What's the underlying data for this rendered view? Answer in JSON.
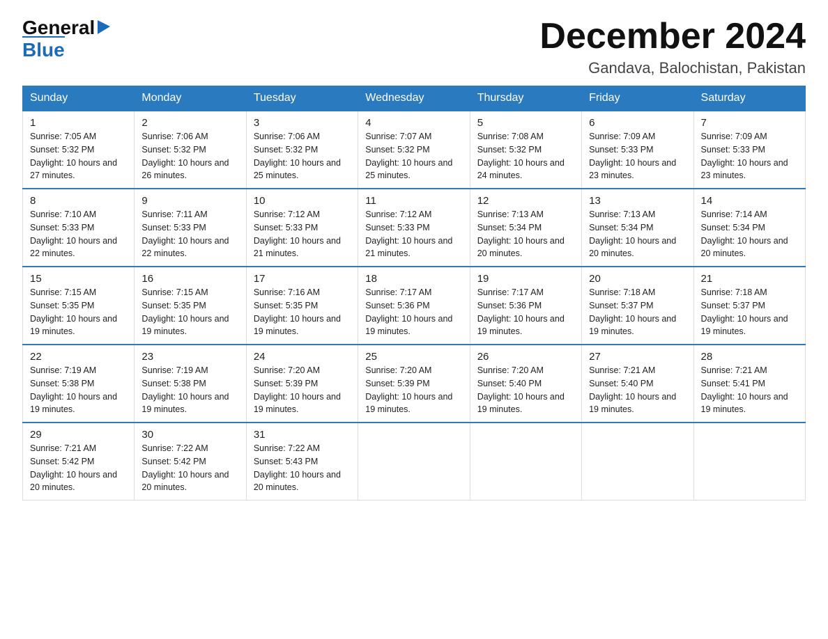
{
  "logo": {
    "general": "General",
    "blue": "Blue",
    "arrow": "▶"
  },
  "title": "December 2024",
  "subtitle": "Gandava, Balochistan, Pakistan",
  "days_of_week": [
    "Sunday",
    "Monday",
    "Tuesday",
    "Wednesday",
    "Thursday",
    "Friday",
    "Saturday"
  ],
  "weeks": [
    [
      {
        "day": "1",
        "sunrise": "7:05 AM",
        "sunset": "5:32 PM",
        "daylight": "10 hours and 27 minutes."
      },
      {
        "day": "2",
        "sunrise": "7:06 AM",
        "sunset": "5:32 PM",
        "daylight": "10 hours and 26 minutes."
      },
      {
        "day": "3",
        "sunrise": "7:06 AM",
        "sunset": "5:32 PM",
        "daylight": "10 hours and 25 minutes."
      },
      {
        "day": "4",
        "sunrise": "7:07 AM",
        "sunset": "5:32 PM",
        "daylight": "10 hours and 25 minutes."
      },
      {
        "day": "5",
        "sunrise": "7:08 AM",
        "sunset": "5:32 PM",
        "daylight": "10 hours and 24 minutes."
      },
      {
        "day": "6",
        "sunrise": "7:09 AM",
        "sunset": "5:33 PM",
        "daylight": "10 hours and 23 minutes."
      },
      {
        "day": "7",
        "sunrise": "7:09 AM",
        "sunset": "5:33 PM",
        "daylight": "10 hours and 23 minutes."
      }
    ],
    [
      {
        "day": "8",
        "sunrise": "7:10 AM",
        "sunset": "5:33 PM",
        "daylight": "10 hours and 22 minutes."
      },
      {
        "day": "9",
        "sunrise": "7:11 AM",
        "sunset": "5:33 PM",
        "daylight": "10 hours and 22 minutes."
      },
      {
        "day": "10",
        "sunrise": "7:12 AM",
        "sunset": "5:33 PM",
        "daylight": "10 hours and 21 minutes."
      },
      {
        "day": "11",
        "sunrise": "7:12 AM",
        "sunset": "5:33 PM",
        "daylight": "10 hours and 21 minutes."
      },
      {
        "day": "12",
        "sunrise": "7:13 AM",
        "sunset": "5:34 PM",
        "daylight": "10 hours and 20 minutes."
      },
      {
        "day": "13",
        "sunrise": "7:13 AM",
        "sunset": "5:34 PM",
        "daylight": "10 hours and 20 minutes."
      },
      {
        "day": "14",
        "sunrise": "7:14 AM",
        "sunset": "5:34 PM",
        "daylight": "10 hours and 20 minutes."
      }
    ],
    [
      {
        "day": "15",
        "sunrise": "7:15 AM",
        "sunset": "5:35 PM",
        "daylight": "10 hours and 19 minutes."
      },
      {
        "day": "16",
        "sunrise": "7:15 AM",
        "sunset": "5:35 PM",
        "daylight": "10 hours and 19 minutes."
      },
      {
        "day": "17",
        "sunrise": "7:16 AM",
        "sunset": "5:35 PM",
        "daylight": "10 hours and 19 minutes."
      },
      {
        "day": "18",
        "sunrise": "7:17 AM",
        "sunset": "5:36 PM",
        "daylight": "10 hours and 19 minutes."
      },
      {
        "day": "19",
        "sunrise": "7:17 AM",
        "sunset": "5:36 PM",
        "daylight": "10 hours and 19 minutes."
      },
      {
        "day": "20",
        "sunrise": "7:18 AM",
        "sunset": "5:37 PM",
        "daylight": "10 hours and 19 minutes."
      },
      {
        "day": "21",
        "sunrise": "7:18 AM",
        "sunset": "5:37 PM",
        "daylight": "10 hours and 19 minutes."
      }
    ],
    [
      {
        "day": "22",
        "sunrise": "7:19 AM",
        "sunset": "5:38 PM",
        "daylight": "10 hours and 19 minutes."
      },
      {
        "day": "23",
        "sunrise": "7:19 AM",
        "sunset": "5:38 PM",
        "daylight": "10 hours and 19 minutes."
      },
      {
        "day": "24",
        "sunrise": "7:20 AM",
        "sunset": "5:39 PM",
        "daylight": "10 hours and 19 minutes."
      },
      {
        "day": "25",
        "sunrise": "7:20 AM",
        "sunset": "5:39 PM",
        "daylight": "10 hours and 19 minutes."
      },
      {
        "day": "26",
        "sunrise": "7:20 AM",
        "sunset": "5:40 PM",
        "daylight": "10 hours and 19 minutes."
      },
      {
        "day": "27",
        "sunrise": "7:21 AM",
        "sunset": "5:40 PM",
        "daylight": "10 hours and 19 minutes."
      },
      {
        "day": "28",
        "sunrise": "7:21 AM",
        "sunset": "5:41 PM",
        "daylight": "10 hours and 19 minutes."
      }
    ],
    [
      {
        "day": "29",
        "sunrise": "7:21 AM",
        "sunset": "5:42 PM",
        "daylight": "10 hours and 20 minutes."
      },
      {
        "day": "30",
        "sunrise": "7:22 AM",
        "sunset": "5:42 PM",
        "daylight": "10 hours and 20 minutes."
      },
      {
        "day": "31",
        "sunrise": "7:22 AM",
        "sunset": "5:43 PM",
        "daylight": "10 hours and 20 minutes."
      },
      null,
      null,
      null,
      null
    ]
  ],
  "labels": {
    "sunrise": "Sunrise:",
    "sunset": "Sunset:",
    "daylight": "Daylight:"
  }
}
